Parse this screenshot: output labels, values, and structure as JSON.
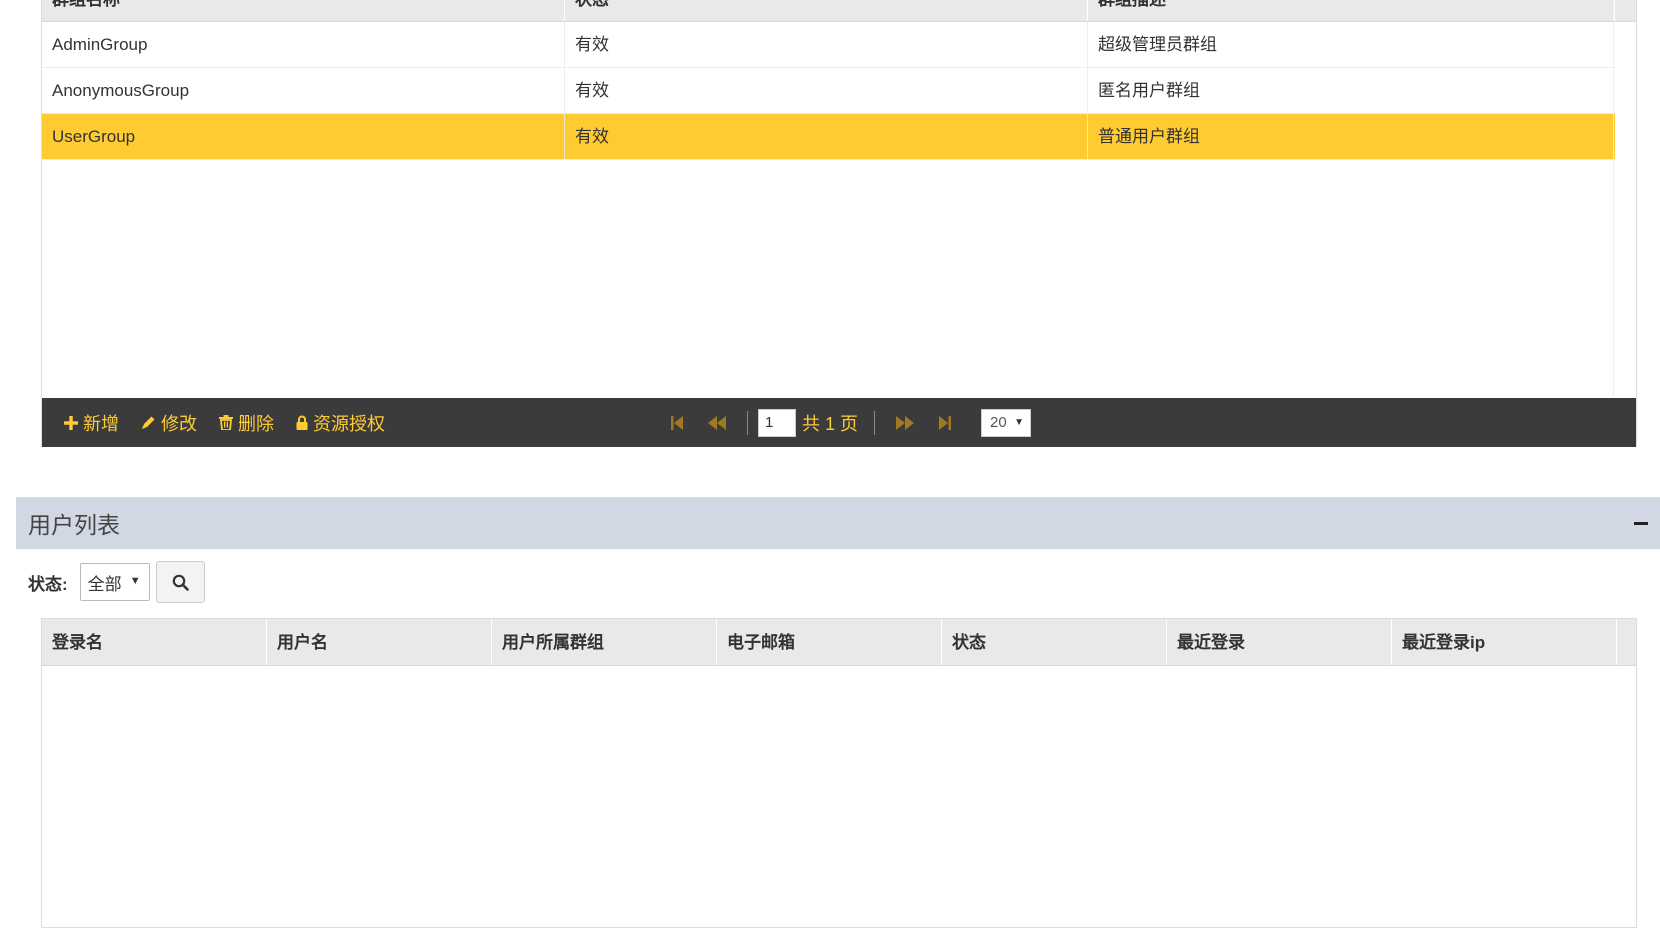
{
  "groups_grid": {
    "columns": [
      "群组名称",
      "状态",
      "群组描述"
    ],
    "rows": [
      {
        "name": "AdminGroup",
        "status": "有效",
        "desc": "超级管理员群组",
        "selected": false
      },
      {
        "name": "AnonymousGroup",
        "status": "有效",
        "desc": "匿名用户群组",
        "selected": false
      },
      {
        "name": "UserGroup",
        "status": "有效",
        "desc": "普通用户群组",
        "selected": true
      }
    ]
  },
  "toolbar": {
    "add_label": "新增",
    "edit_label": "修改",
    "delete_label": "删除",
    "auth_label": "资源授权",
    "accent": "#ffcb33"
  },
  "pager": {
    "current_page": "1",
    "total_label": "共 1 页",
    "page_size": "20"
  },
  "users_section": {
    "title": "用户列表",
    "filter_label": "状态:",
    "filter_value": "全部",
    "columns": [
      "登录名",
      "用户名",
      "用户所属群组",
      "电子邮箱",
      "状态",
      "最近登录",
      "最近登录ip"
    ]
  }
}
